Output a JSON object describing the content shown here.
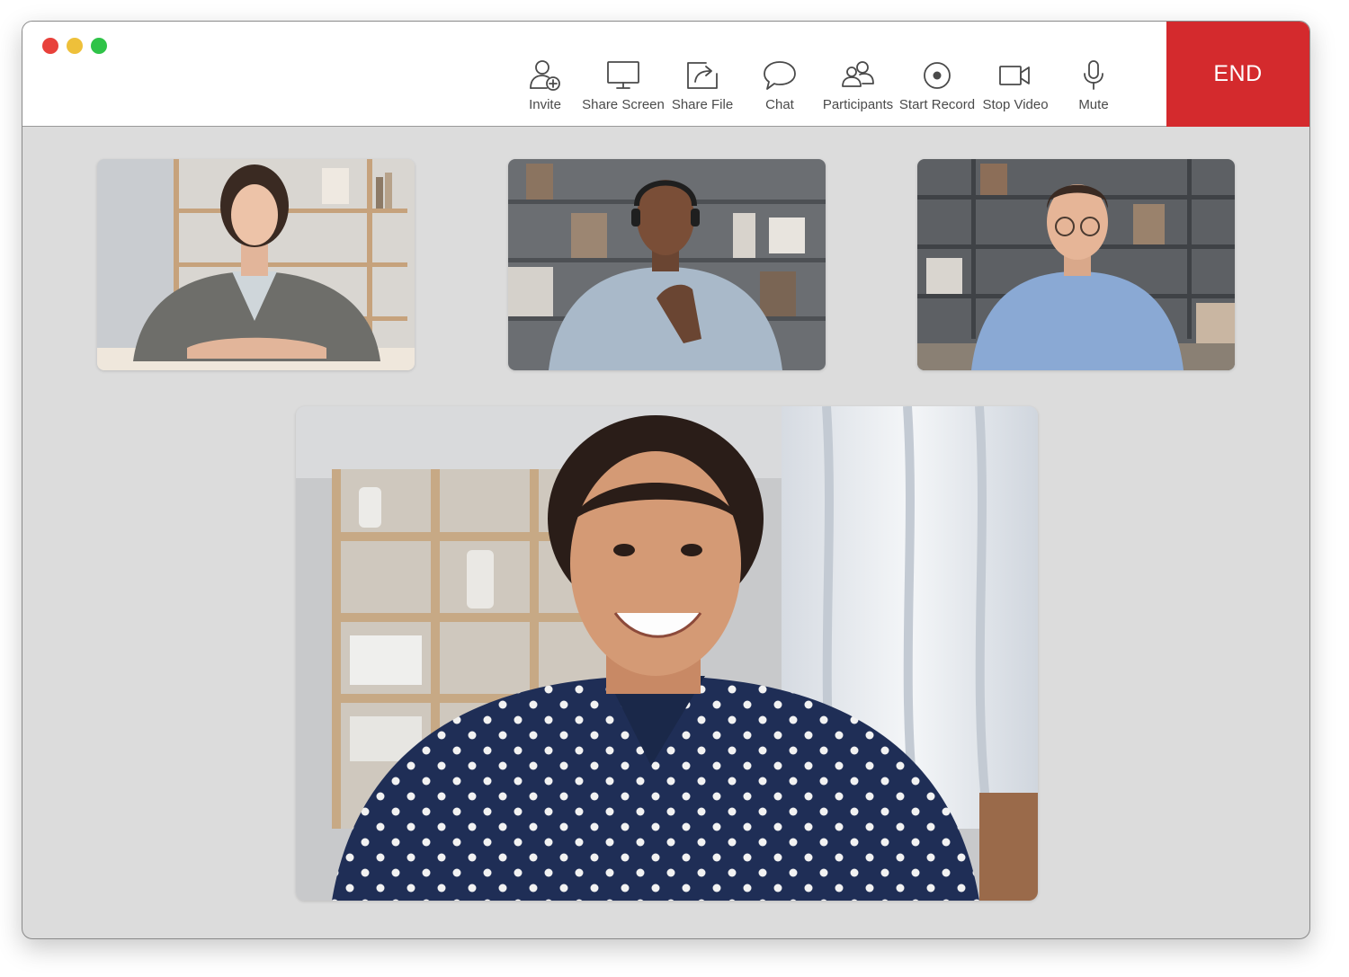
{
  "window": {
    "controls": [
      "close",
      "minimize",
      "maximize"
    ]
  },
  "toolbar": {
    "items": [
      {
        "label": "Invite",
        "icon": "add-user-icon"
      },
      {
        "label": "Share Screen",
        "icon": "monitor-icon"
      },
      {
        "label": "Share File",
        "icon": "share-file-icon"
      },
      {
        "label": "Chat",
        "icon": "chat-bubble-icon"
      },
      {
        "label": "Participants",
        "icon": "participants-icon"
      },
      {
        "label": "Start Record",
        "icon": "record-icon"
      },
      {
        "label": "Stop Video",
        "icon": "video-camera-icon"
      },
      {
        "label": "Mute",
        "icon": "microphone-icon"
      }
    ],
    "end_label": "END"
  },
  "colors": {
    "end_button": "#d42a2d",
    "stage_background": "#dcdcdc",
    "toolbar_background": "#ffffff",
    "icon_stroke": "#4a4a4a",
    "close_dot": "#e8413b",
    "minimize_dot": "#eec03a",
    "maximize_dot": "#2fc348"
  },
  "video_tiles": [
    {
      "participant": "woman in grey cardigan",
      "view": "thumbnail"
    },
    {
      "participant": "man with headset",
      "view": "thumbnail"
    },
    {
      "participant": "man with glasses",
      "view": "thumbnail"
    },
    {
      "participant": "woman in polka-dot shirt",
      "view": "active-speaker"
    }
  ]
}
